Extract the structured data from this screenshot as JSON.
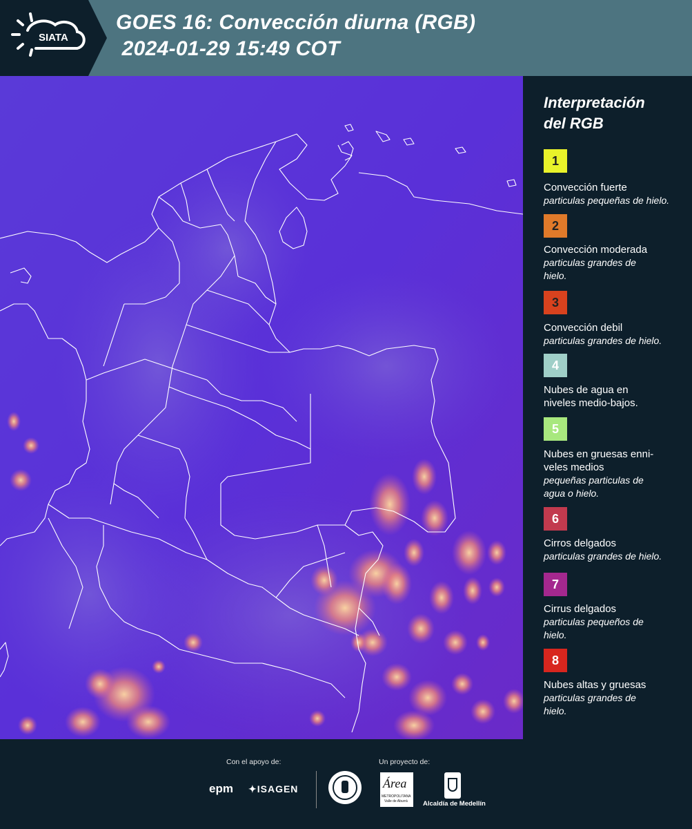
{
  "header": {
    "logo_text": "SIATA",
    "title_line1": "GOES 16: Convección diurna (RGB)",
    "title_line2": " 2024-01-29 15:49 COT",
    "bg_color": "#4d7480"
  },
  "legend": {
    "title_line1": "Interpretación",
    "title_line2": "del RGB",
    "items": [
      {
        "number": "1",
        "color": "#e9f22a",
        "text_color": "#222222",
        "line1": "Convección fuerte",
        "line2": "",
        "sub1": "particulas pequeñas de hielo.",
        "sub2": ""
      },
      {
        "number": "2",
        "color": "#e07a2a",
        "text_color": "#222222",
        "line1": "Convección moderada",
        "line2": "",
        "sub1": "particulas grandes de",
        "sub2": "hielo."
      },
      {
        "number": "3",
        "color": "#d8421e",
        "text_color": "#222222",
        "line1": "Convección debil",
        "line2": "",
        "sub1": "particulas grandes de hielo.",
        "sub2": ""
      },
      {
        "number": "4",
        "color": "#9fcfc8",
        "text_color": "#ffffff",
        "line1": "Nubes de agua en",
        "line2": "niveles medio-bajos.",
        "sub1": "",
        "sub2": ""
      },
      {
        "number": "5",
        "color": "#a8e87e",
        "text_color": "#ffffff",
        "line1": "Nubes en gruesas enni-",
        "line2": "veles medios",
        "sub1": "pequeñas particulas de",
        "sub2": "agua o hielo."
      },
      {
        "number": "6",
        "color": "#c23a4e",
        "text_color": "#ffffff",
        "line1": "Cirros delgados",
        "line2": "",
        "sub1": "particulas grandes de hielo.",
        "sub2": ""
      },
      {
        "number": "7",
        "color": "#a4288e",
        "text_color": "#ffffff",
        "line1": "Cirrus delgados",
        "line2": "",
        "sub1": "particulas pequeños de",
        "sub2": "hielo."
      },
      {
        "number": "8",
        "color": "#d8261e",
        "text_color": "#ffffff",
        "line1": "Nubes altas y gruesas",
        "line2": "",
        "sub1": "particulas grandes de",
        "sub2": "hielo."
      }
    ]
  },
  "footer": {
    "support_label": "Con el apoyo de:",
    "project_label": "Un proyecto de:",
    "epm": "epm",
    "isagen": "ISAGEN",
    "area_logo": "Área",
    "area_caption1": "METROPOLITANA",
    "area_caption2": "Valle de Aburrá",
    "alcaldia": "Alcaldía de Medellín"
  },
  "map": {
    "background_color": "#5a32d6",
    "border_color": "#ffffff"
  }
}
